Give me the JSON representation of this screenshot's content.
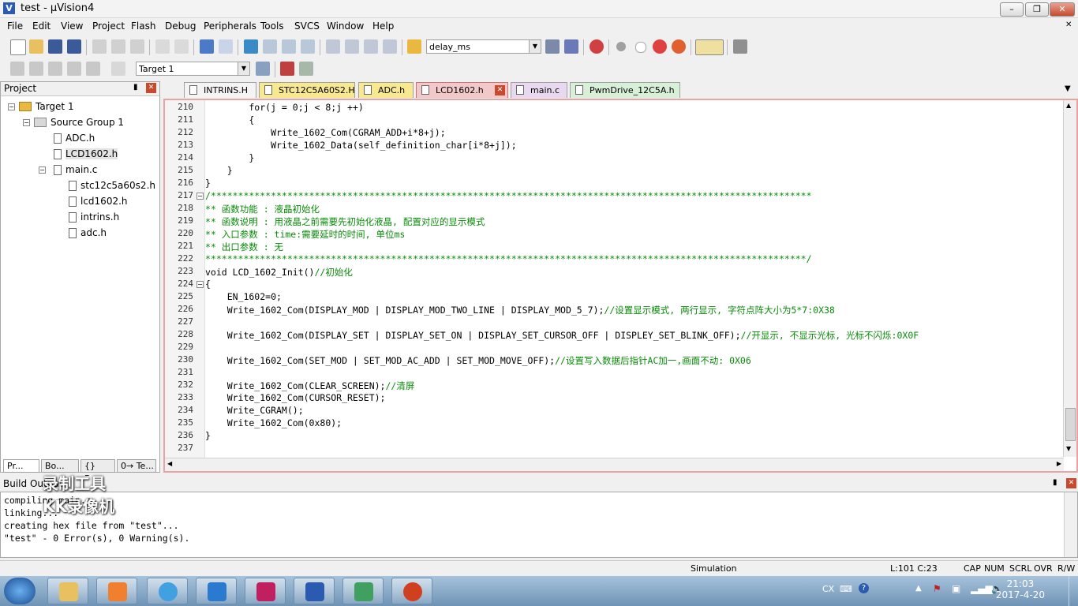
{
  "window": {
    "title": "test - µVision4"
  },
  "menu": [
    "File",
    "Edit",
    "View",
    "Project",
    "Flash",
    "Debug",
    "Peripherals",
    "Tools",
    "SVCS",
    "Window",
    "Help"
  ],
  "toolbar": {
    "find_combo": "delay_ms",
    "target_combo": "Target 1"
  },
  "project": {
    "title": "Project",
    "target": "Target 1",
    "group": "Source Group 1",
    "files": [
      "ADC.h",
      "LCD1602.h",
      "main.c"
    ],
    "includes": [
      "stc12c5a60s2.h",
      "lcd1602.h",
      "intrins.h",
      "adc.h"
    ],
    "tabs": [
      "Pr...",
      "Bo...",
      "{} Fu...",
      "0→ Te..."
    ]
  },
  "editor": {
    "tabs": [
      "INTRINS.H",
      "STC12C5A60S2.H",
      "ADC.h",
      "LCD1602.h",
      "main.c",
      "PwmDrive_12C5A.h"
    ],
    "active_tab": "LCD1602.h",
    "lines": [
      {
        "n": "210",
        "t": "        for(j = 0;j < 8;j ++)"
      },
      {
        "n": "211",
        "t": "        {"
      },
      {
        "n": "212",
        "t": "            Write_1602_Com(CGRAM_ADD+i*8+j);"
      },
      {
        "n": "213",
        "t": "            Write_1602_Data(self_definition_char[i*8+j]);"
      },
      {
        "n": "214",
        "t": "        }"
      },
      {
        "n": "215",
        "t": "    }"
      },
      {
        "n": "216",
        "t": "}"
      },
      {
        "n": "217",
        "t": "/**************************************************************************************************************",
        "c": true
      },
      {
        "n": "218",
        "t": "** 函数功能 : 液晶初始化",
        "c": true
      },
      {
        "n": "219",
        "t": "** 函数说明 : 用液晶之前需要先初始化液晶, 配置对应的显示模式",
        "c": true
      },
      {
        "n": "220",
        "t": "** 入口参数 : time:需要延时的时间, 单位ms",
        "c": true
      },
      {
        "n": "221",
        "t": "** 出口参数 : 无",
        "c": true
      },
      {
        "n": "222",
        "t": "**************************************************************************************************************/",
        "c": true
      },
      {
        "n": "223",
        "t": "void LCD_1602_Init()",
        "cm": "//初始化"
      },
      {
        "n": "224",
        "t": "{"
      },
      {
        "n": "225",
        "t": "    EN_1602=0;"
      },
      {
        "n": "226",
        "t": "    Write_1602_Com(DISPLAY_MOD | DISPLAY_MOD_TWO_LINE | DISPLAY_MOD_5_7);",
        "cm": "//设置显示模式, 两行显示, 字符点阵大小为5*7:0X38"
      },
      {
        "n": "227",
        "t": ""
      },
      {
        "n": "228",
        "t": "    Write_1602_Com(DISPLAY_SET | DISPLAY_SET_ON | DISPLAY_SET_CURSOR_OFF | DISPLEY_SET_BLINK_OFF);",
        "cm": "//开显示, 不显示光标, 光标不闪烁:0X0F"
      },
      {
        "n": "229",
        "t": ""
      },
      {
        "n": "230",
        "t": "    Write_1602_Com(SET_MOD | SET_MOD_AC_ADD | SET_MOD_MOVE_OFF);",
        "cm": "//设置写入数据后指针AC加一,画面不动: 0X06"
      },
      {
        "n": "231",
        "t": ""
      },
      {
        "n": "232",
        "t": "    Write_1602_Com(CLEAR_SCREEN);",
        "cm": "//清屏"
      },
      {
        "n": "233",
        "t": "    Write_1602_Com(CURSOR_RESET);"
      },
      {
        "n": "234",
        "t": "    Write_CGRAM();"
      },
      {
        "n": "235",
        "t": "    Write_1602_Com(0x80);"
      },
      {
        "n": "236",
        "t": "}"
      },
      {
        "n": "237",
        "t": ""
      }
    ]
  },
  "build": {
    "title": "Build Output",
    "lines": [
      "compiling main.c...",
      "linking...",
      "creating hex file from \"test\"...",
      "\"test\" - 0 Error(s), 0 Warning(s)."
    ]
  },
  "status": {
    "mode": "Simulation",
    "position": "L:101 C:23",
    "caps": "CAP",
    "num": "NUM",
    "scrl": "SCRL",
    "ovr": "OVR",
    "rw": "R/W"
  },
  "watermark": [
    "录制工具",
    "KK录像机"
  ],
  "taskbar": {
    "ime": "CX",
    "time": "21:03",
    "date": "2017-4-20"
  }
}
